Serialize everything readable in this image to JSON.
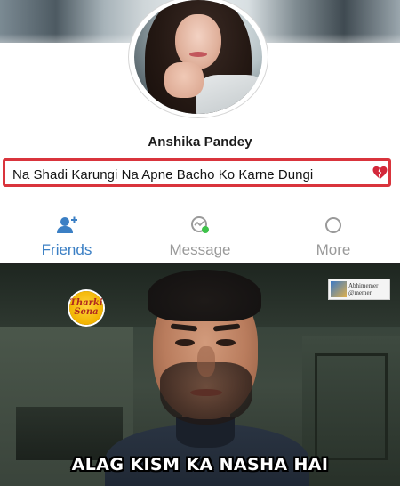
{
  "profile": {
    "name": "Anshika Pandey",
    "bio": "Na Shadi Karungi Na Apne Bacho Ko Karne Dungi",
    "bio_emoji_icon": "broken-heart-icon",
    "highlight_color": "#d9343c"
  },
  "actions": [
    {
      "label": "Friends",
      "icon": "add-friend-icon",
      "color": "#3b7fc4"
    },
    {
      "label": "Message",
      "icon": "message-icon",
      "color": "#9a9a9a"
    },
    {
      "label": "More",
      "icon": "more-circle-icon",
      "color": "#9a9a9a"
    }
  ],
  "meme": {
    "caption": "ALAG KISM KA NASHA HAI",
    "logo_text": "Tharki Sena",
    "watermark_text": "Abhimemer @memer"
  }
}
